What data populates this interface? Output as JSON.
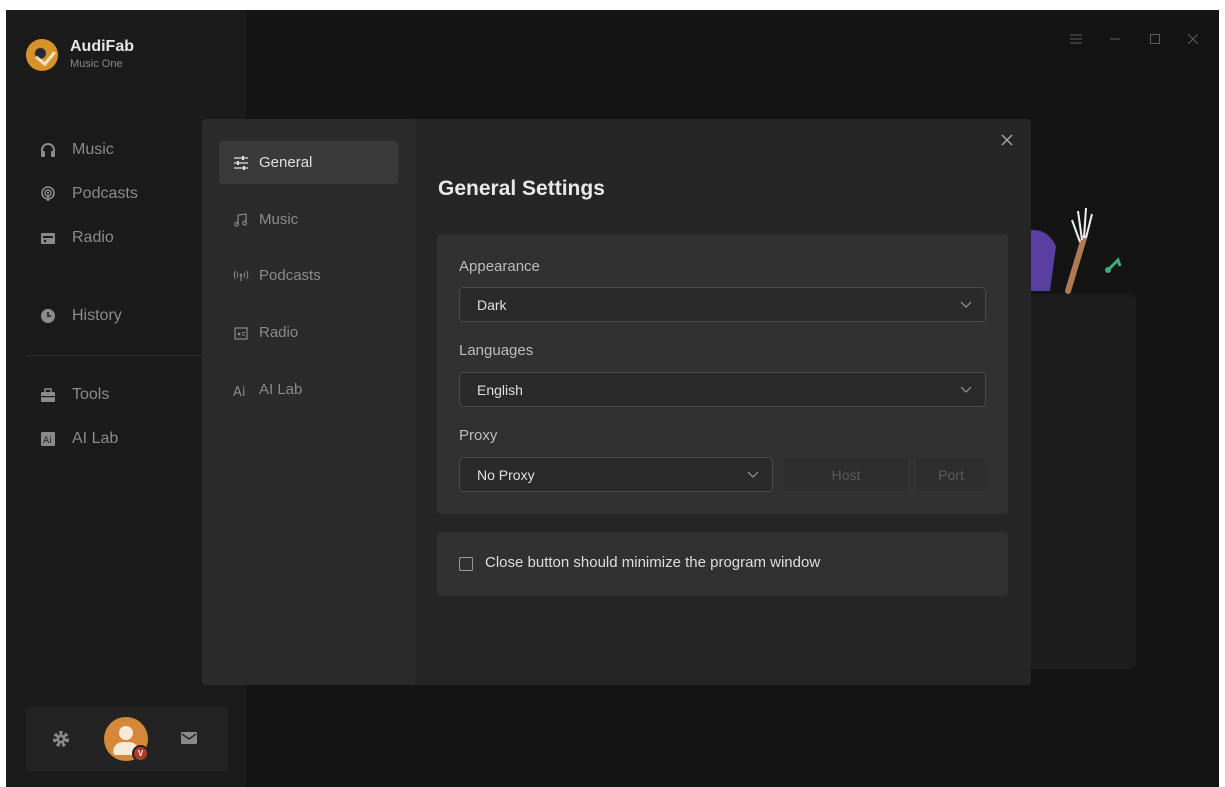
{
  "app": {
    "name": "AudiFab",
    "subtitle": "Music One"
  },
  "sidebar": {
    "items": [
      {
        "label": "Music",
        "icon": "headphones-icon"
      },
      {
        "label": "Podcasts",
        "icon": "podcast-icon"
      },
      {
        "label": "Radio",
        "icon": "radio-icon"
      },
      {
        "label": "History",
        "icon": "clock-icon"
      },
      {
        "label": "Tools",
        "icon": "toolbox-icon"
      },
      {
        "label": "AI Lab",
        "icon": "ai-icon"
      }
    ]
  },
  "window_controls": [
    "menu-icon",
    "minimize-icon",
    "maximize-icon",
    "close-icon"
  ],
  "dialog": {
    "tabs": [
      {
        "label": "General",
        "icon": "sliders-icon",
        "active": true
      },
      {
        "label": "Music",
        "icon": "music-note-icon"
      },
      {
        "label": "Podcasts",
        "icon": "podcast-icon"
      },
      {
        "label": "Radio",
        "icon": "radio-icon"
      },
      {
        "label": "AI Lab",
        "icon": "ai-icon"
      }
    ],
    "title": "General Settings",
    "appearance": {
      "label": "Appearance",
      "value": "Dark"
    },
    "languages": {
      "label": "Languages",
      "value": "English"
    },
    "proxy": {
      "label": "Proxy",
      "value": "No Proxy",
      "host_placeholder": "Host",
      "port_placeholder": "Port"
    },
    "minimize_option": {
      "label": "Close button should minimize the program window",
      "checked": false
    }
  },
  "colors": {
    "background": "#141414",
    "sidebar": "#1b1b1b",
    "dialog": "#262626",
    "panel": "#313131",
    "accent": "#d8922a"
  }
}
